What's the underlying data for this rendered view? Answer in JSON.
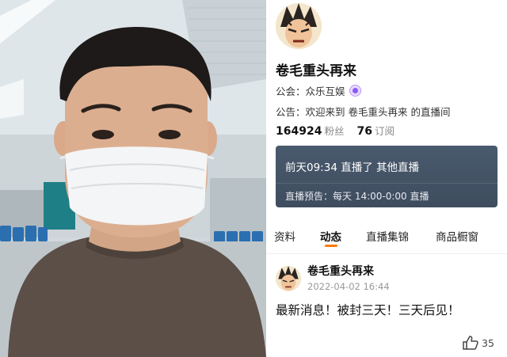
{
  "profile": {
    "username": "卷毛重头再来",
    "guild_label": "公会：",
    "guild_name": "众乐互娱",
    "guild_badge_icon": "guild-badge-icon",
    "notice_label": "公告：",
    "notice_text": "欢迎来到 卷毛重头再来 的直播间",
    "followers": {
      "value": "164924",
      "label": "粉丝"
    },
    "subscriptions": {
      "value": "76",
      "label": "订阅"
    }
  },
  "live_card": {
    "last_live": "前天09:34 直播了 其他直播",
    "schedule": "直播预告：每天 14:00-0:00 直播"
  },
  "tabs": [
    {
      "label": "资料",
      "active": false
    },
    {
      "label": "动态",
      "active": true
    },
    {
      "label": "直播集锦",
      "active": false
    },
    {
      "label": "商品橱窗",
      "active": false
    }
  ],
  "post": {
    "author": "卷毛重头再来",
    "time": "2022-04-02 16:44",
    "text": "最新消息！被封三天！三天后见！",
    "likes": "35"
  },
  "colors": {
    "accent_tab_underline": "#ff7a00",
    "live_card_bg": "#44536a",
    "guild_badge": "#8a5cf6"
  }
}
